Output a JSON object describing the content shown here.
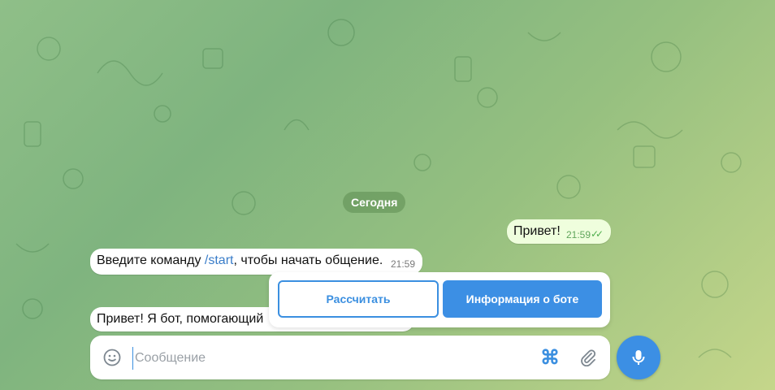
{
  "date_separator": "Сегодня",
  "messages": [
    {
      "direction": "out",
      "text": "Привет!",
      "time": "21:59",
      "status": "read"
    },
    {
      "direction": "in",
      "text_before": "Введите команду ",
      "command": "/start",
      "text_after": ", чтобы начать общение.",
      "time": "21:59"
    },
    {
      "direction": "in",
      "text": "Привет! Я бот, помогающий"
    }
  ],
  "keyboard": {
    "buttons": [
      {
        "label": "Рассчитать",
        "style": "outline"
      },
      {
        "label": "Информация о боте",
        "style": "solid"
      }
    ]
  },
  "composer": {
    "placeholder": "Сообщение",
    "icons": [
      "smile-icon",
      "command-icon",
      "paperclip-icon",
      "microphone-icon"
    ]
  },
  "colors": {
    "accent": "#3c8fe4",
    "outgoing_bubble": "#effedd",
    "incoming_bubble": "#ffffff",
    "read_check": "#4fae4e"
  }
}
